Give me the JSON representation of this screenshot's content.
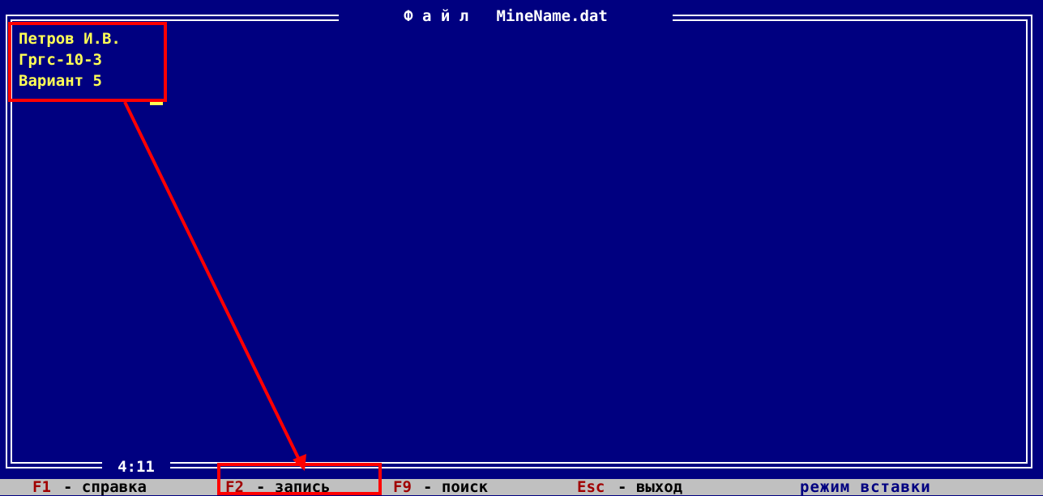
{
  "window": {
    "title": "Ф а й л   MineName.dat",
    "cursor_position": "4:11"
  },
  "editor": {
    "lines": [
      "Петров И.В.",
      "Гргс-10-3",
      "Вариант 5"
    ]
  },
  "statusbar": {
    "items": [
      {
        "key": "F1",
        "label": "- справка"
      },
      {
        "key": "F2",
        "label": "- запись"
      },
      {
        "key": "F9",
        "label": "- поиск"
      },
      {
        "key": "Esc",
        "label": "- выход"
      }
    ],
    "mode": "режим вставки"
  },
  "colors": {
    "screen_background": "#000080",
    "editor_text": "#ffff55",
    "frame": "#ffffff",
    "statusbar_background": "#c0c0c0",
    "key_text": "#a00000",
    "annotation": "#ff0000"
  }
}
